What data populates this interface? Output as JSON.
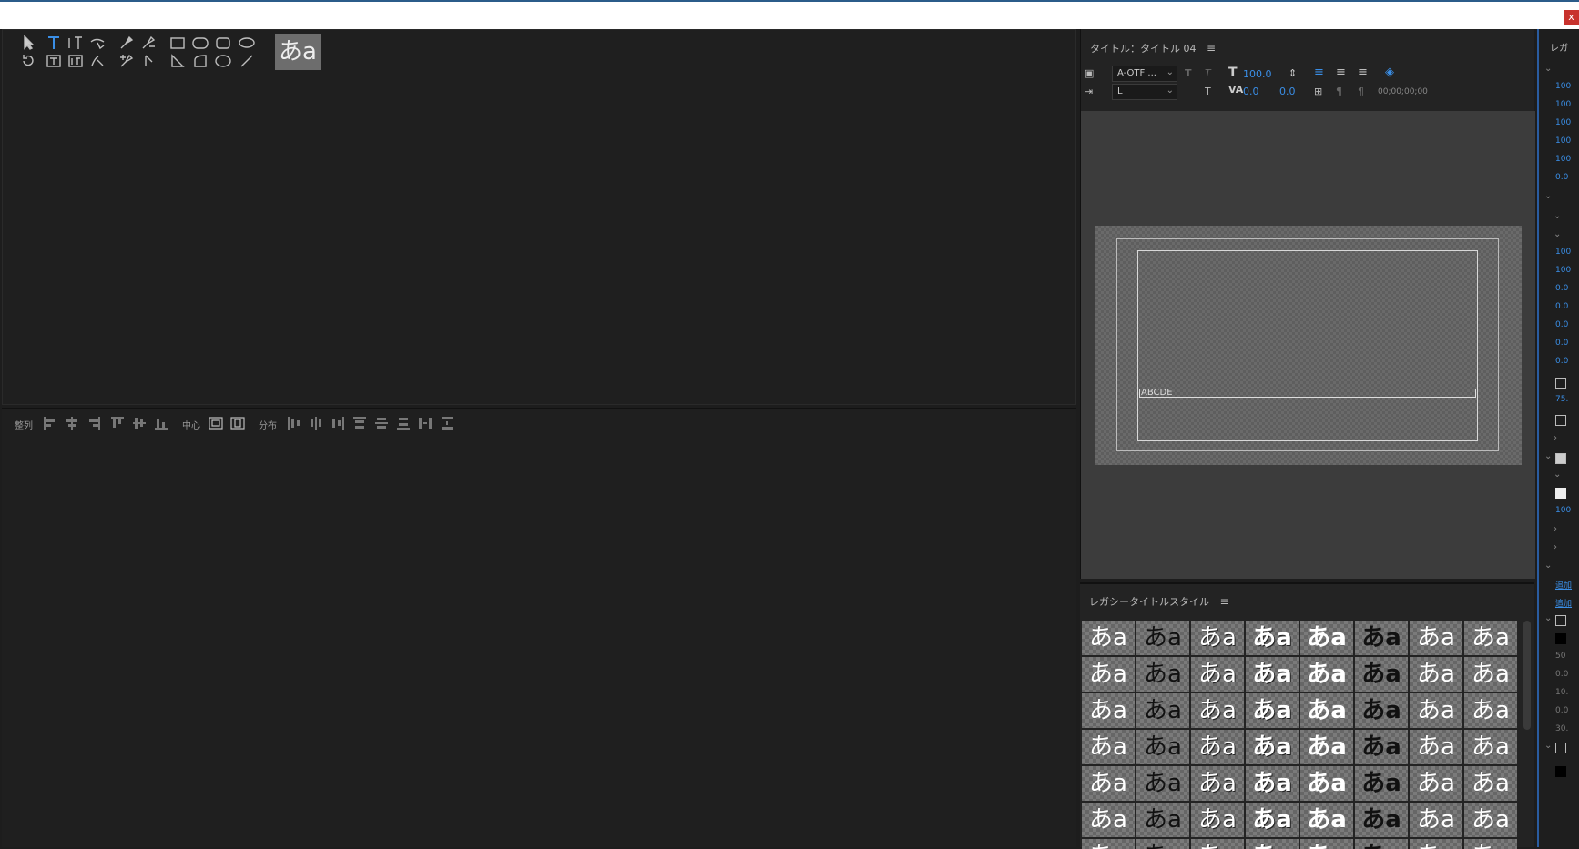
{
  "window": {
    "close_label": "x"
  },
  "tools": {
    "sample_label": "あa",
    "items": [
      "selection-tool",
      "type-tool",
      "vertical-type-tool",
      "path-type-tool",
      "pen-tool",
      "delete-anchor-tool",
      "rectangle-tool",
      "rounded-rect-tool",
      "clipped-corner-rect-tool",
      "rounded-corner-rect-tool",
      "rotation-tool",
      "area-type-tool",
      "vertical-area-type-tool",
      "vertical-path-type-tool",
      "add-anchor-tool",
      "convert-anchor-tool",
      "wedge-tool",
      "arc-tool",
      "ellipse-tool",
      "line-tool"
    ]
  },
  "align": {
    "label_align": "整列",
    "label_center": "中心",
    "label_distribute": "分布"
  },
  "title_panel": {
    "header": "タイトル：タイトル 04",
    "menu_icon": "≡",
    "font_family": "A-OTF ...",
    "font_style": "L",
    "font_size": "100.0",
    "kerning": "0.0",
    "tracking": "0.0",
    "timecode": "00;00;00;00",
    "text_object": "ABCDE"
  },
  "styles_panel": {
    "header": "レガシータイトルスタイル",
    "menu_icon": "≡",
    "swatch_text": "あa",
    "swatch_count": 56
  },
  "properties": {
    "header": "レガ",
    "values": [
      "100",
      "100",
      "100",
      "100",
      "100",
      "0.0",
      "100",
      "100",
      "0.0",
      "0.0",
      "0.0",
      "0.0",
      "0.0",
      "75.",
      "100",
      "追加",
      "追加",
      "50",
      "0.0",
      "10.",
      "0.0",
      "30."
    ]
  }
}
